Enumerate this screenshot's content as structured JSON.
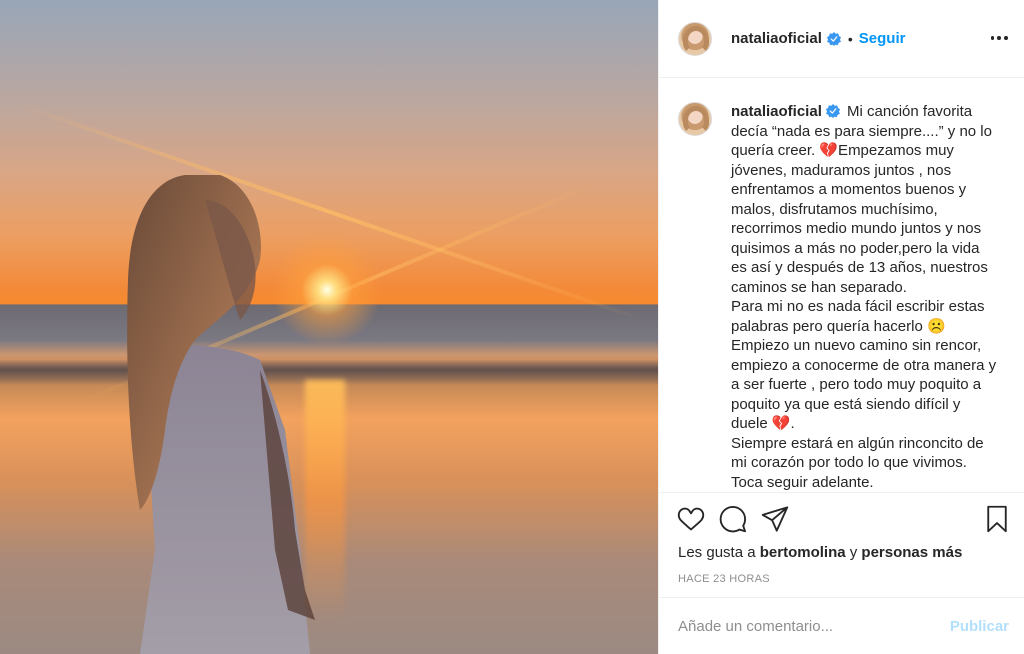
{
  "post": {
    "author": "nataliaoficial",
    "follow_label": "Seguir",
    "separator": "•",
    "caption_text": "Mi canción favorita decía “nada es para siempre....” y no lo quería creer. 💔Empezamos muy jóvenes, maduramos juntos , nos enfrentamos a momentos buenos y malos, disfrutamos muchísimo, recorrimos medio mundo juntos y nos quisimos a más no poder,pero la vida es así y después de 13 años, nuestros caminos se han separado.\nPara mi no es nada fácil escribir estas palabras pero quería hacerlo ☹️\nEmpiezo un nuevo camino sin rencor, empiezo a conocerme de otra manera y a ser fuerte , pero todo muy poquito a poquito ya que está siendo difícil y duele 💔.\nSiempre estará en algún rinconcito de mi corazón por todo lo que vivimos.\nToca seguir adelante."
  },
  "likes": {
    "prefix": "Les gusta a",
    "user": "bertomolina",
    "middle": "y",
    "suffix": "personas más"
  },
  "timestamp": "HACE 23 HORAS",
  "comment": {
    "placeholder": "Añade un comentario...",
    "publish_label": "Publicar"
  },
  "icons": {
    "verified": "verified-badge-icon",
    "more": "more-options-icon",
    "like": "heart-icon",
    "comment": "comment-icon",
    "share": "share-icon",
    "save": "bookmark-icon"
  },
  "colors": {
    "accent": "#0095f6",
    "publish_disabled": "#b2dffc",
    "muted": "#8e8e8e",
    "text": "#262626"
  }
}
